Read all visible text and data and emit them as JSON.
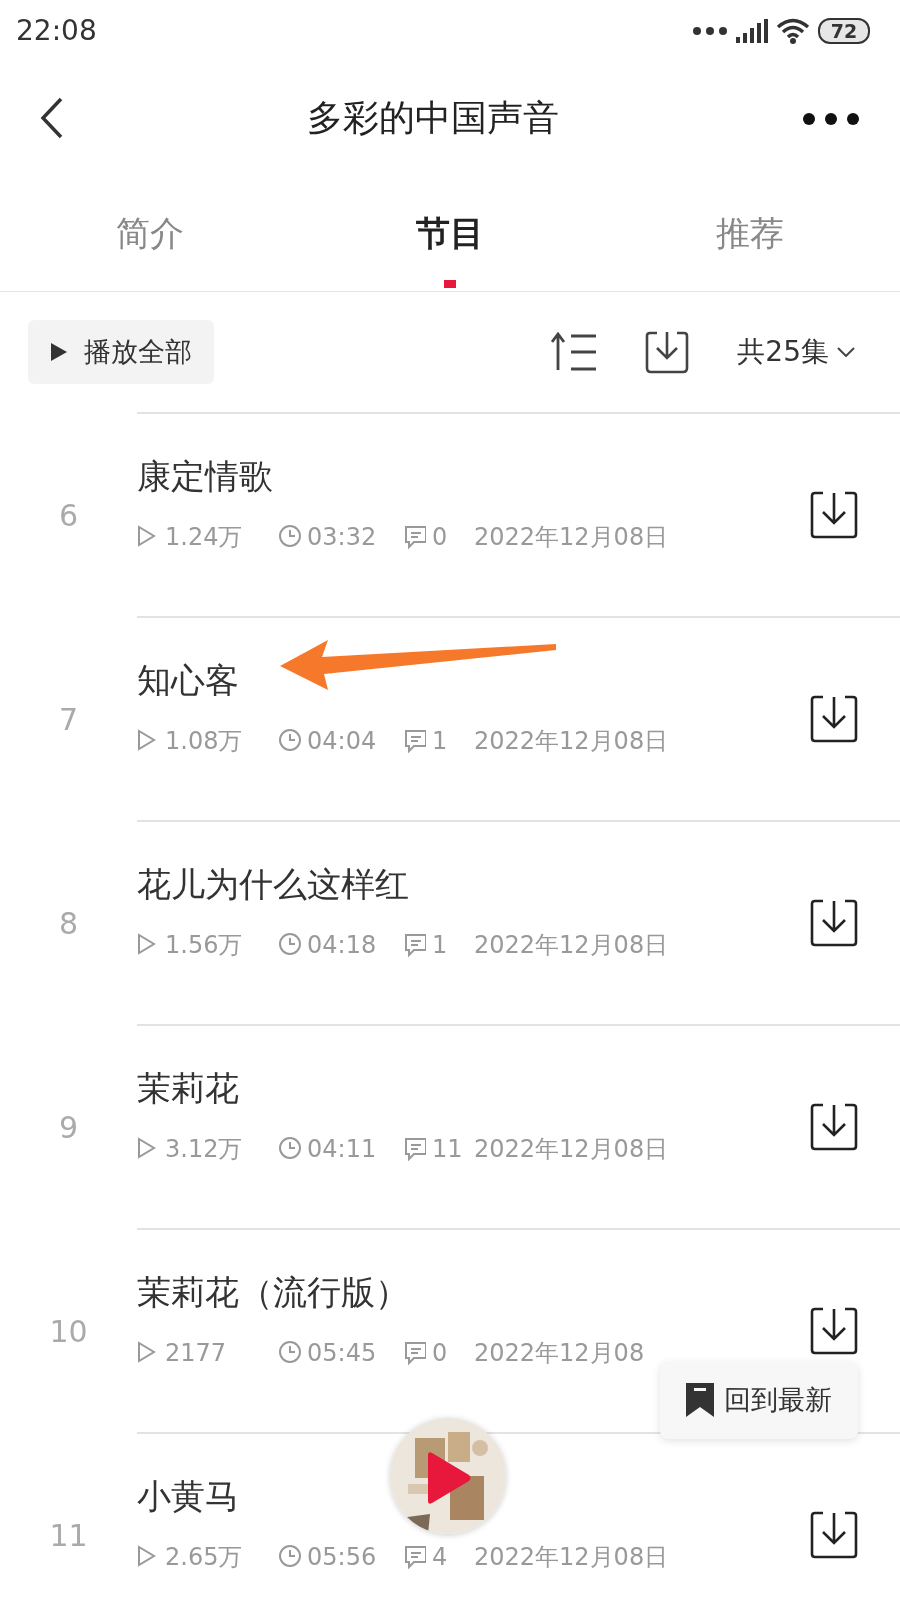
{
  "status_bar": {
    "time": "22:08",
    "battery": "72"
  },
  "header": {
    "title": "多彩的中国声音"
  },
  "tabs": [
    {
      "label": "简介",
      "selected": false
    },
    {
      "label": "节目",
      "selected": true
    },
    {
      "label": "推荐",
      "selected": false
    }
  ],
  "toolbar": {
    "play_all": "播放全部",
    "episode_count": "共25集"
  },
  "episodes": [
    {
      "index": "6",
      "title": "康定情歌",
      "plays": "1.24万",
      "duration": "03:32",
      "comments": "0",
      "date": "2022年12月08日"
    },
    {
      "index": "7",
      "title": "知心客",
      "plays": "1.08万",
      "duration": "04:04",
      "comments": "1",
      "date": "2022年12月08日"
    },
    {
      "index": "8",
      "title": "花儿为什么这样红",
      "plays": "1.56万",
      "duration": "04:18",
      "comments": "1",
      "date": "2022年12月08日"
    },
    {
      "index": "9",
      "title": "茉莉花",
      "plays": "3.12万",
      "duration": "04:11",
      "comments": "11",
      "date": "2022年12月08日"
    },
    {
      "index": "10",
      "title": "茉莉花（流行版）",
      "plays": "2177",
      "duration": "05:45",
      "comments": "0",
      "date": "2022年12月08"
    },
    {
      "index": "11",
      "title": "小黄马",
      "plays": "2.65万",
      "duration": "05:56",
      "comments": "4",
      "date": "2022年12月08日"
    }
  ],
  "back_to_latest": {
    "label": "回到最新"
  }
}
